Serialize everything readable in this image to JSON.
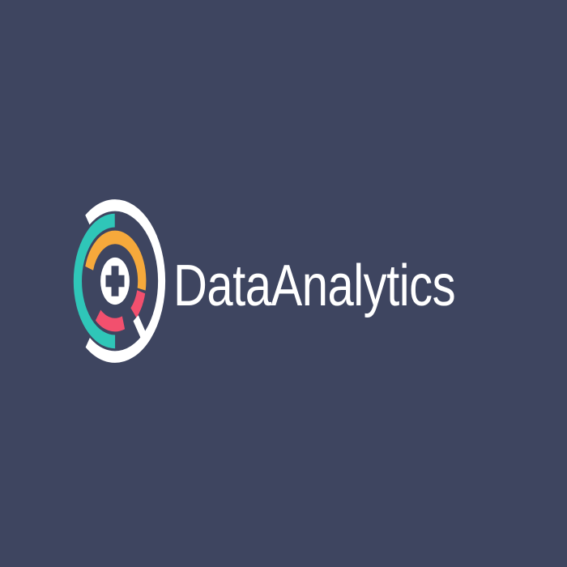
{
  "brand": {
    "name": "DataAnalytics",
    "colors": {
      "background": "#3e4560",
      "white": "#ffffff",
      "teal": "#2fc6b8",
      "orange": "#f6a93b",
      "pink": "#f2506e",
      "dark": "#3e4560"
    }
  }
}
